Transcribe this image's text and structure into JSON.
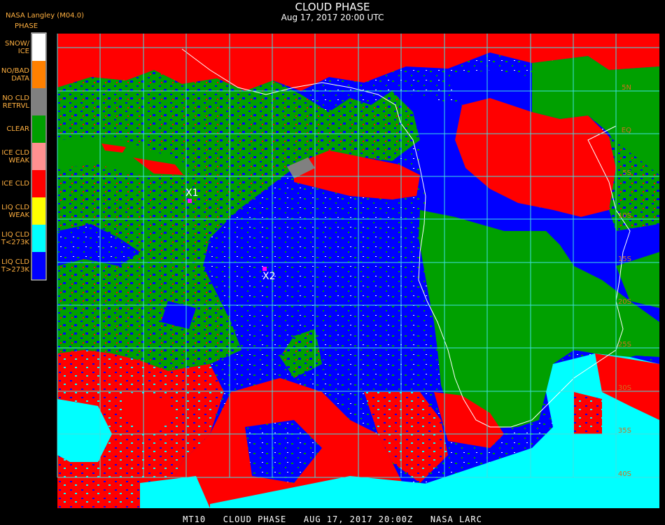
{
  "header": {
    "title": "CLOUD PHASE",
    "subtitle": "Aug 17, 2017 20:00 UTC",
    "producer": "NASA Langley (M04.0)"
  },
  "legend": {
    "title": "PHASE",
    "items": [
      {
        "label": "SNOW/\nICE",
        "color": "#ffffff"
      },
      {
        "label": "NO/BAD\nDATA",
        "color": "#ff8000"
      },
      {
        "label": "NO CLD\nRETRVL",
        "color": "#808080"
      },
      {
        "label": "CLEAR",
        "color": "#00a000"
      },
      {
        "label": "ICE CLD\nWEAK",
        "color": "#ff9090"
      },
      {
        "label": "ICE CLD",
        "color": "#ff0000"
      },
      {
        "label": "LIQ CLD\nWEAK",
        "color": "#ffff00"
      },
      {
        "label": "LIQ CLD\nT<273K",
        "color": "#00ffff"
      },
      {
        "label": "LIQ CLD\nT>273K",
        "color": "#0000ff"
      }
    ]
  },
  "map": {
    "grid_color": "#40e0e0",
    "coast_color": "#ffffff",
    "lat_labels": [
      "5N",
      "EQ",
      "5S",
      "10S",
      "15S",
      "20S",
      "25S",
      "30S",
      "35S",
      "40S"
    ],
    "markers": [
      {
        "label": "X1",
        "color": "#ff00ff"
      },
      {
        "label": "X2",
        "color": "#ff00ff"
      }
    ]
  },
  "footer": "MT10   CLOUD PHASE   AUG 17, 2017 20:00Z   NASA LARC"
}
